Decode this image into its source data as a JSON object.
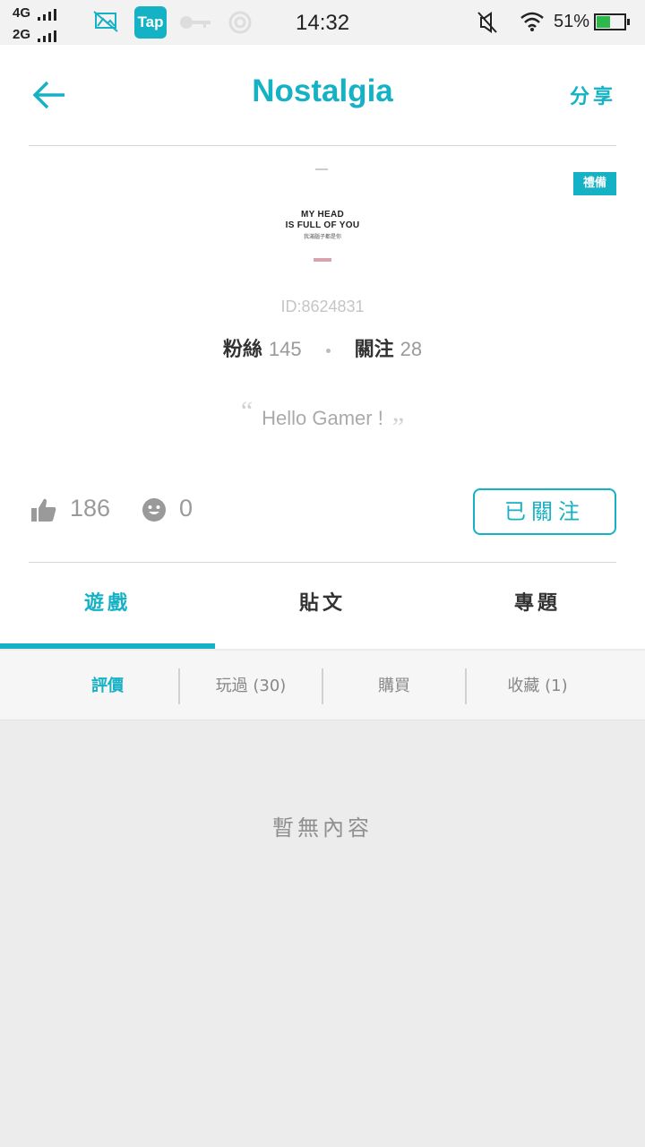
{
  "status_bar": {
    "network_1": "4G",
    "network_2": "2G",
    "app_badge": "Tap",
    "time": "14:32",
    "battery": "51%",
    "battery_level": 0.51
  },
  "header": {
    "title": "Nostalgia",
    "share_label": "分享"
  },
  "profile": {
    "badge": "禮備",
    "avatar_text_1": "MY HEAD",
    "avatar_text_2": "IS FULL OF YOU",
    "avatar_text_3": "我滿腦子都是你",
    "id": "ID:8624831",
    "fans_label": "粉絲",
    "fans_count": "145",
    "follow_label": "關注",
    "follow_count": "28",
    "motto": "Hello Gamer !",
    "likes": "186",
    "smiles": "0",
    "follow_button": "已關注"
  },
  "tabs": [
    {
      "label": "遊戲",
      "active": true
    },
    {
      "label": "貼文",
      "active": false
    },
    {
      "label": "專題",
      "active": false
    }
  ],
  "subtabs": [
    {
      "label": "評價",
      "active": true
    },
    {
      "label": "玩過 (30)",
      "active": false
    },
    {
      "label": "購買",
      "active": false
    },
    {
      "label": "收藏 (1)",
      "active": false
    }
  ],
  "empty_message": "暫無內容",
  "colors": {
    "accent": "#15b1c4",
    "background": "#ececec"
  }
}
